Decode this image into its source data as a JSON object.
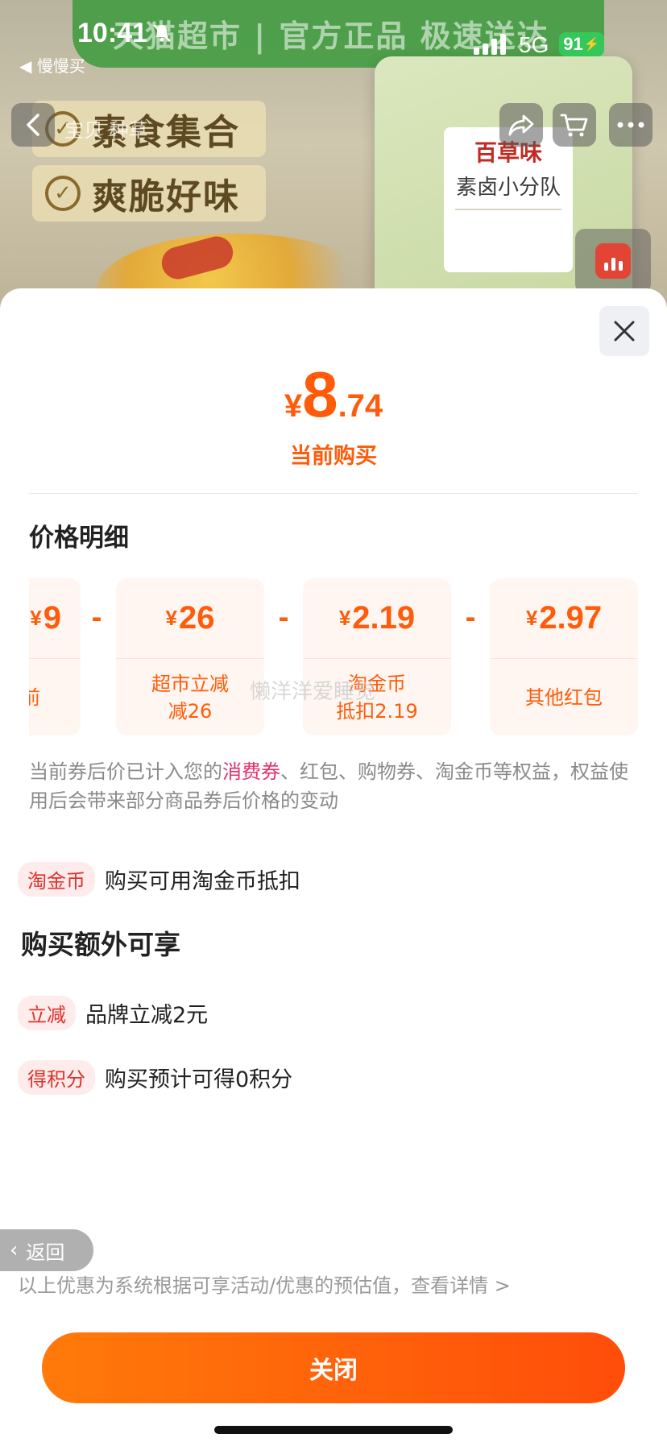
{
  "status_bar": {
    "time": "10:41",
    "back_app": "◀ 慢慢买",
    "network": "5G",
    "battery": "91"
  },
  "banner": {
    "slogan": "天猫超市 | 官方正品 极速送达",
    "features": [
      "素食集合",
      "爽脆好味"
    ],
    "product_brand": "百草味",
    "product_name": "素卤小分队",
    "nav_label": "宝贝 种草"
  },
  "sheet": {
    "price": {
      "symbol": "¥",
      "integer": "8",
      "decimal": ".74"
    },
    "price_caption": "当前购买",
    "detail_title": "价格明细",
    "breakdown": [
      {
        "amount": "9",
        "label": "前"
      },
      {
        "amount": "26",
        "label": "超市立减\n减26"
      },
      {
        "amount": "2.19",
        "label": "淘金币\n抵扣2.19"
      },
      {
        "amount": "2.97",
        "label": "其他红包"
      }
    ],
    "operator": "-",
    "currency": "¥",
    "watermark": "懒洋洋爱睡觉",
    "note_pre": "当前券后价已计入您的",
    "note_hl": "消费券",
    "note_post": "、红包、购物券、淘金币等权益，权益使用后会带来部分商品券后价格的变动",
    "coin_tag": "淘金币",
    "coin_text": "购买可用淘金币抵扣",
    "extra_title": "购买额外可享",
    "extras": [
      {
        "tag": "立减",
        "text": "品牌立减2元"
      },
      {
        "tag": "得积分",
        "text": "购买预计可得0积分"
      }
    ],
    "return_label": "返回",
    "footnote": "以上优惠为系统根据可享活动/优惠的预估值，查看详情 >",
    "close_label": "关闭"
  },
  "colors": {
    "accent": "#ff5b0a",
    "tag_red": "#e0302a",
    "highlight": "#e0306a"
  }
}
